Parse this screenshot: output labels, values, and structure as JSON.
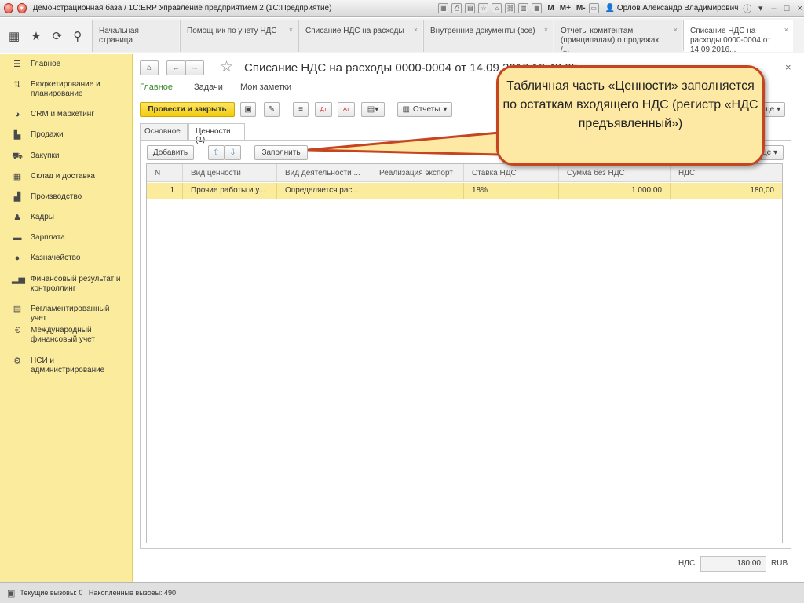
{
  "titlebar": {
    "title": "Демонстрационная база / 1С:ERP Управление предприятием 2 (1С:Предприятие)",
    "m_labels": [
      "M",
      "M+",
      "M-"
    ],
    "user": "Орлов Александр Владимирович"
  },
  "tabs": [
    {
      "label": "Начальная страница"
    },
    {
      "label": "Помощник по учету НДС"
    },
    {
      "label": "Списание НДС на расходы"
    },
    {
      "label": "Внутренние документы (все)"
    },
    {
      "label": "Отчеты комитентам (принципалам) о продажах /..."
    },
    {
      "label": "Списание НДС на расходы 0000-0004 от 14.09.2016..."
    }
  ],
  "sidebar": {
    "items": [
      {
        "label": "Главное",
        "icon": "list-icon"
      },
      {
        "label": "Бюджетирование и планирование",
        "icon": "budget-icon"
      },
      {
        "label": "CRM и маркетинг",
        "icon": "crm-icon"
      },
      {
        "label": "Продажи",
        "icon": "bag-icon"
      },
      {
        "label": "Закупки",
        "icon": "cart-icon"
      },
      {
        "label": "Склад и доставка",
        "icon": "warehouse-icon"
      },
      {
        "label": "Производство",
        "icon": "factory-icon"
      },
      {
        "label": "Кадры",
        "icon": "person-icon"
      },
      {
        "label": "Зарплата",
        "icon": "wallet-icon"
      },
      {
        "label": "Казначейство",
        "icon": "treasury-icon"
      },
      {
        "label": "Финансовый результат и контроллинг",
        "icon": "bar-chart-icon"
      },
      {
        "label": "Регламентированный учет",
        "icon": "ledger-icon"
      },
      {
        "label": "Международный финансовый учет",
        "icon": "euro-icon"
      },
      {
        "label": "НСИ и администрирование",
        "icon": "gear-icon"
      }
    ]
  },
  "document": {
    "title": "Списание НДС на расходы 0000-0004 от 14.09.2016 10:48:25",
    "subnav": [
      "Главное",
      "Задачи",
      "Мои заметки"
    ],
    "post_close_label": "Провести и закрыть",
    "reports_label": "Отчеты",
    "more_label": "Еще",
    "inner_tabs": [
      "Основное",
      "Ценности (1)"
    ],
    "add_label": "Добавить",
    "fill_label": "Заполнить",
    "grid_more_label": "Еще"
  },
  "table": {
    "headers": [
      "N",
      "Вид ценности",
      "Вид деятельности ...",
      "Реализация экспорт",
      "Ставка НДС",
      "Сумма без НДС",
      "НДС"
    ],
    "rows": [
      [
        "1",
        "Прочие работы и у...",
        "Определяется рас...",
        "",
        "18%",
        "1 000,00",
        "180,00"
      ]
    ]
  },
  "footer": {
    "vat_label": "НДС:",
    "vat_value": "180,00",
    "currency": "RUB"
  },
  "statusbar": {
    "text": "Текущие вызовы: 0   Накопленные вызовы: 490"
  },
  "callout": {
    "text": "Табличная часть «Ценности» заполняется по остаткам входящего НДС (регистр «НДС предъявленный»)"
  },
  "colors": {
    "sidebar_bg": "#fbec9d",
    "accent_green": "#3d8a2d",
    "primary_button": "#f2cc0c",
    "callout_border": "#c64520",
    "callout_bg": "#fde9a4"
  }
}
